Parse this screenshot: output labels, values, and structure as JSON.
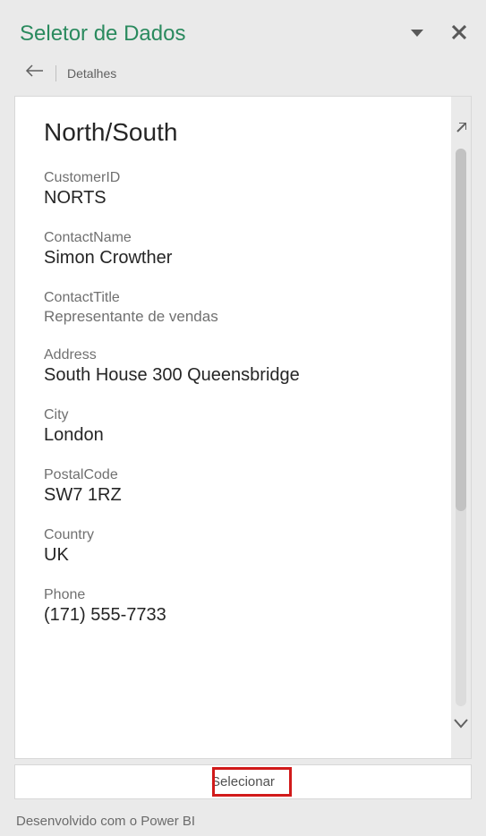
{
  "header": {
    "title": "Seletor de Dados"
  },
  "breadcrumb": {
    "label": "Detalhes"
  },
  "page": {
    "heading": "North/South"
  },
  "fields": {
    "customerId": {
      "label": "CustomerID",
      "value": "NORTS"
    },
    "contactName": {
      "label": "ContactName",
      "value": "Simon Crowther"
    },
    "contactTitle": {
      "label": "ContactTitle",
      "value": "Representante de vendas"
    },
    "address": {
      "label": "Address",
      "value": "South House 300 Queensbridge"
    },
    "city": {
      "label": "City",
      "value": "London"
    },
    "postalCode": {
      "label": "PostalCode",
      "value": "SW7 1RZ"
    },
    "country": {
      "label": "Country",
      "value": "UK"
    },
    "phone": {
      "label": "Phone",
      "value": "(171) 555-7733"
    }
  },
  "actions": {
    "select_label": "Selecionar"
  },
  "footer": {
    "text": "Desenvolvido com o Power BI"
  }
}
